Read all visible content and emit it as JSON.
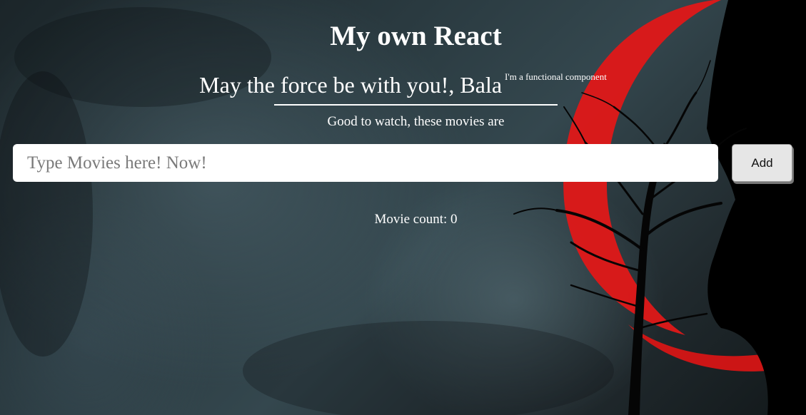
{
  "header": {
    "title": "My own React",
    "greeting": "May the force be with you!, Bala",
    "greeting_note": "I'm a functional component",
    "subtitle": "Good to watch, these movies are"
  },
  "movie_form": {
    "input_value": "",
    "input_placeholder": "Type Movies here! Now!",
    "add_label": "Add"
  },
  "movie_count": {
    "label": "Movie count: 0"
  },
  "theme": {
    "background_base": "#2a3a40",
    "moon_red": "#e01818",
    "silhouette": "#000000",
    "text": "#ffffff"
  }
}
